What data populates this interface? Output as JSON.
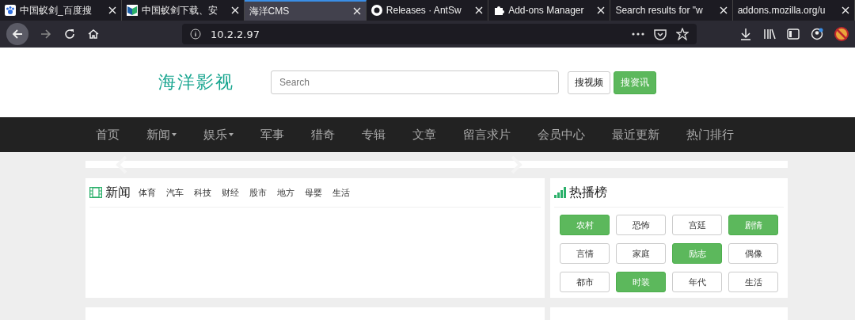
{
  "browser": {
    "tabs": [
      {
        "title": "中国蚁剑_百度搜",
        "selected": false
      },
      {
        "title": "中国蚁剑下载、安",
        "selected": false
      },
      {
        "title": "海洋CMS",
        "selected": true
      },
      {
        "title": "Releases · AntSw",
        "selected": false
      },
      {
        "title": "Add-ons Manager",
        "selected": false
      },
      {
        "title": "Search results for \"w",
        "selected": false
      },
      {
        "title": "addons.mozilla.org/u",
        "selected": false
      }
    ],
    "address": "10.2.2.97"
  },
  "site": {
    "logo": "海洋影视",
    "search": {
      "placeholder": "Search"
    },
    "buttons": [
      {
        "label": "搜视频",
        "primary": false
      },
      {
        "label": "搜资讯",
        "primary": true
      }
    ]
  },
  "nav": [
    {
      "label": "首页",
      "dropdown": false
    },
    {
      "label": "新闻",
      "dropdown": true
    },
    {
      "label": "娱乐",
      "dropdown": true
    },
    {
      "label": "军事",
      "dropdown": false
    },
    {
      "label": "猎奇",
      "dropdown": false
    },
    {
      "label": "专辑",
      "dropdown": false
    },
    {
      "label": "文章",
      "dropdown": false
    },
    {
      "label": "留言求片",
      "dropdown": false
    },
    {
      "label": "会员中心",
      "dropdown": false
    },
    {
      "label": "最近更新",
      "dropdown": false
    },
    {
      "label": "热门排行",
      "dropdown": false
    }
  ],
  "sections": [
    {
      "title": "新闻",
      "links": [
        "体育",
        "汽车",
        "科技",
        "财经",
        "股市",
        "地方",
        "母婴",
        "生活"
      ],
      "side": {
        "title": "热播榜",
        "tags": [
          {
            "label": "农村",
            "selected": true
          },
          {
            "label": "恐怖",
            "selected": false
          },
          {
            "label": "宫廷",
            "selected": false
          },
          {
            "label": "剧情",
            "selected": true
          },
          {
            "label": "言情",
            "selected": false
          },
          {
            "label": "家庭",
            "selected": false
          },
          {
            "label": "励志",
            "selected": true
          },
          {
            "label": "偶像",
            "selected": false
          },
          {
            "label": "都市",
            "selected": false
          },
          {
            "label": "时装",
            "selected": true
          },
          {
            "label": "年代",
            "selected": false
          },
          {
            "label": "生活",
            "selected": false
          }
        ]
      }
    }
  ]
}
